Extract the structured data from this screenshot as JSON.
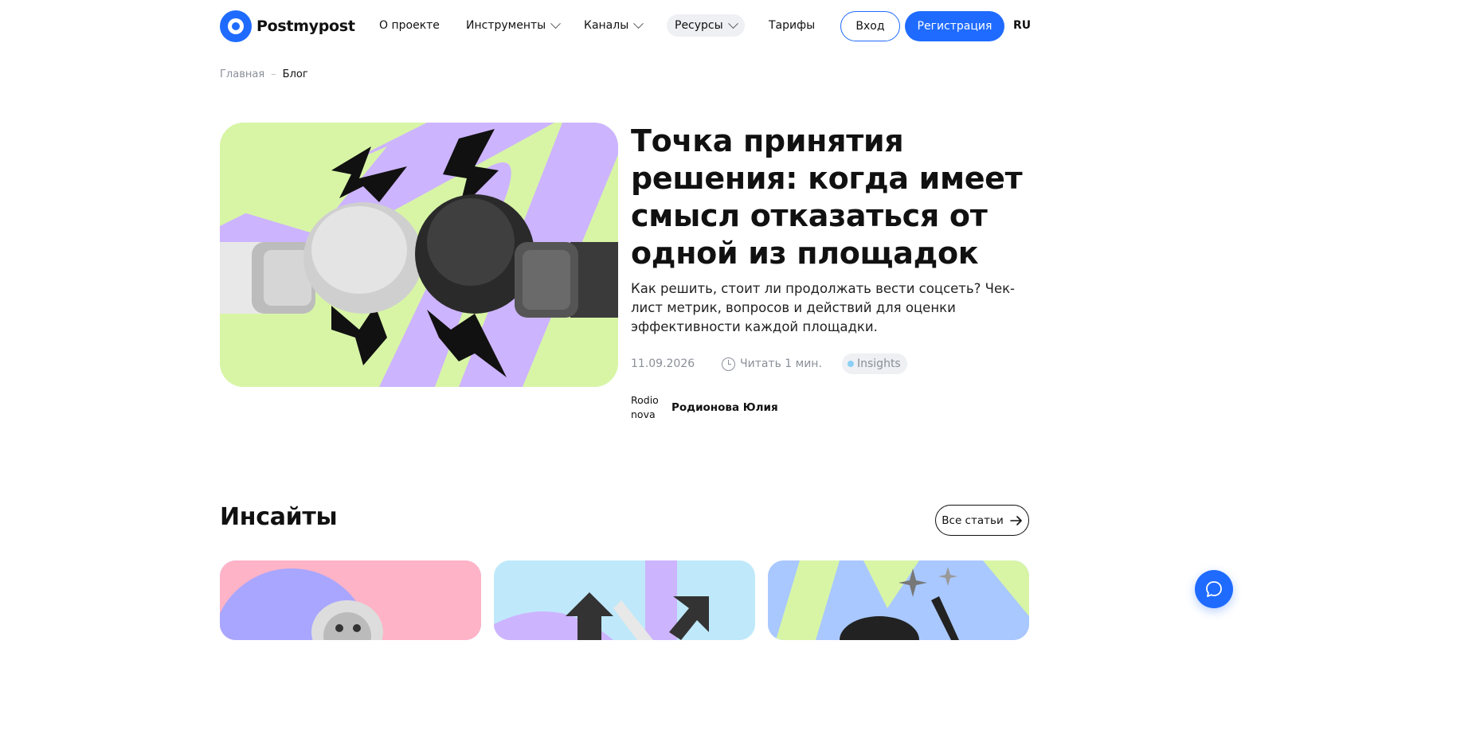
{
  "header": {
    "logo_text": "Postmypost",
    "nav": {
      "about": "О проекте",
      "tools": "Инструменты",
      "channels": "Каналы",
      "resources": "Ресурсы",
      "pricing": "Тарифы"
    },
    "login_label": "Вход",
    "register_label": "Регистрация",
    "language": "RU"
  },
  "breadcrumb": {
    "home": "Главная",
    "separator": "–",
    "current": "Блог"
  },
  "hero": {
    "title": "Точка принятия решения: когда имеет смысл отказаться от одной из площадок",
    "subtitle": "Как решить, стоит ли продолжать вести соцсеть? Чек-лист метрик, вопросов и действий для оценки эффективности каждой площадки.",
    "date": "11.09.2026",
    "read_time": "Читать 1 мин.",
    "tag": "Insights",
    "author_avatar_alt": "Rodionova",
    "author_name": "Родионова Юлия"
  },
  "insights": {
    "title": "Инсайты",
    "all_articles_label": "Все статьи"
  },
  "colors": {
    "brand_blue": "#1f6bff",
    "hero_green": "#d8f5a6",
    "hero_purple": "#cdb4ff",
    "tag_dot": "#8ccff5"
  }
}
